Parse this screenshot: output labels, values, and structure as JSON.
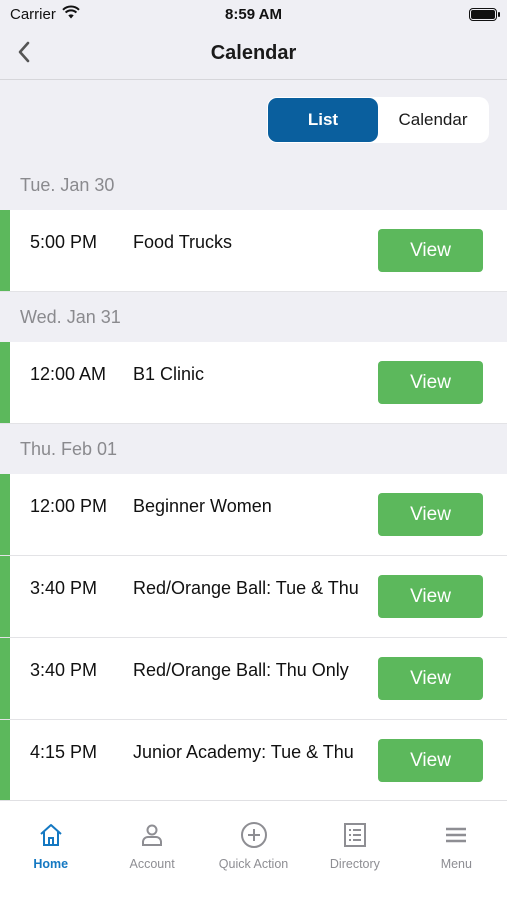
{
  "status_bar": {
    "carrier": "Carrier",
    "time": "8:59 AM"
  },
  "nav": {
    "title": "Calendar"
  },
  "segmented": {
    "list_label": "List",
    "calendar_label": "Calendar"
  },
  "groups": [
    {
      "date": "Tue. Jan 30",
      "events": [
        {
          "time": "5:00 PM",
          "title": "Food Trucks",
          "action": "View"
        }
      ]
    },
    {
      "date": "Wed. Jan 31",
      "events": [
        {
          "time": "12:00 AM",
          "title": "B1 Clinic",
          "action": "View"
        }
      ]
    },
    {
      "date": "Thu. Feb 01",
      "events": [
        {
          "time": "12:00 PM",
          "title": "Beginner Women",
          "action": "View"
        },
        {
          "time": "3:40 PM",
          "title": "Red/Orange Ball: Tue & Thu",
          "action": "View"
        },
        {
          "time": "3:40 PM",
          "title": "Red/Orange Ball: Thu Only",
          "action": "View"
        },
        {
          "time": "4:15 PM",
          "title": "Junior Academy: Tue & Thu",
          "action": "View"
        }
      ]
    }
  ],
  "tabs": [
    {
      "label": "Home",
      "icon": "home-icon"
    },
    {
      "label": "Account",
      "icon": "person-icon"
    },
    {
      "label": "Quick Action",
      "icon": "plus-circle-icon"
    },
    {
      "label": "Directory",
      "icon": "list-icon"
    },
    {
      "label": "Menu",
      "icon": "menu-icon"
    }
  ],
  "colors": {
    "accent_blue": "#0a5f9e",
    "active_tab": "#1478c2",
    "view_green": "#5cb85c"
  }
}
